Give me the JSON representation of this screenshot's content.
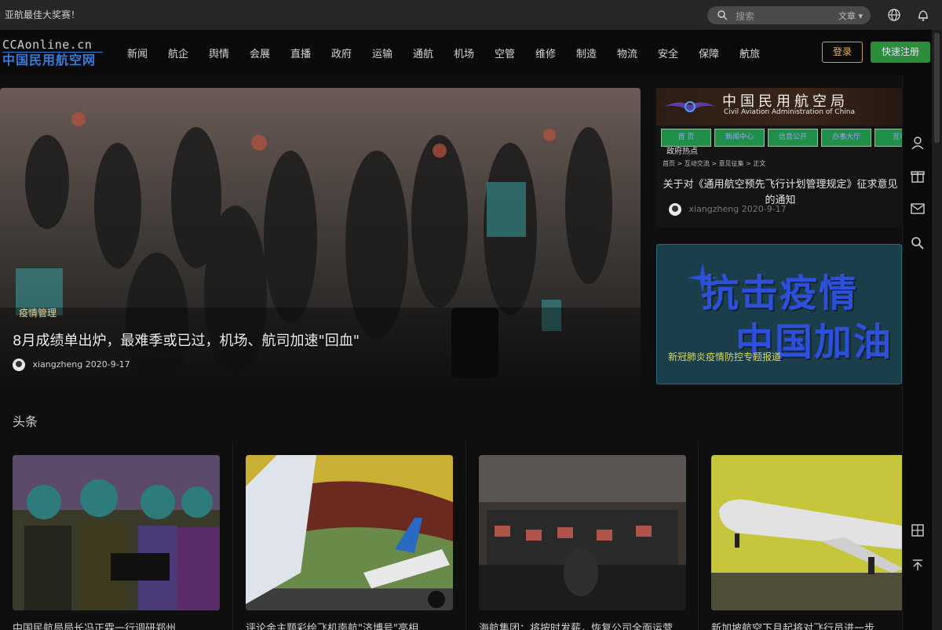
{
  "topbar": {
    "notice": "亚航最佳大奖赛！",
    "search_placeholder": "搜索",
    "search_type": "文章"
  },
  "header": {
    "logo_line1": "CCAonline.cn",
    "logo_line2": "中国民用航空网",
    "nav": [
      "新闻",
      "航企",
      "舆情",
      "会展",
      "直播",
      "政府",
      "运输",
      "通航",
      "机场",
      "空管",
      "维修",
      "制造",
      "物流",
      "安全",
      "保障",
      "航旅"
    ],
    "login_label": "登录",
    "register_label": "快速注册"
  },
  "hero": {
    "tag": "疫情管理",
    "title": "8月成绩单出炉，最难季或已过，机场、航司加速\"回血\"",
    "author": "xiangzheng",
    "date": "2020-9-17"
  },
  "side_card_1": {
    "banner_cn": "中国民用航空局",
    "banner_en": "Civil Aviation Administration of China",
    "nav": [
      "首 页",
      "新闻中心",
      "信息公开",
      "办事大厅",
      "互动"
    ],
    "tag": "政府热点",
    "breadcrumb": "首页 > 互动交流 > 意见征集 > 正文",
    "title": "关于对《通用航空预先飞行计划管理规定》征求意见的通知",
    "author": "xiangzheng",
    "date": "2020-9-17"
  },
  "side_card_2": {
    "big_line1": "抗击疫情",
    "big_line2": "中国加油",
    "caption": "新冠肺炎疫情防控专题报道"
  },
  "headlines": {
    "section_title": "头条",
    "items": [
      "中国民航局局长冯正霖一行调研郑州",
      "评论金主题彩绘飞机南航\"济博号\"亮相",
      "海航集团：将按时发薪，恢复公司全面运营",
      "新加坡航空下月起将对飞行员进一步"
    ]
  },
  "colors": {
    "accent_blue": "#2f7de0",
    "login_gold": "#e4b659",
    "register_green": "#2a8e3a",
    "hero_tag": "#e6cf9a"
  },
  "icons": [
    "search-icon",
    "globe-icon",
    "bell-icon",
    "user-icon",
    "gift-icon",
    "mail-icon",
    "search-icon",
    "grid-icon",
    "back-to-top-icon"
  ]
}
